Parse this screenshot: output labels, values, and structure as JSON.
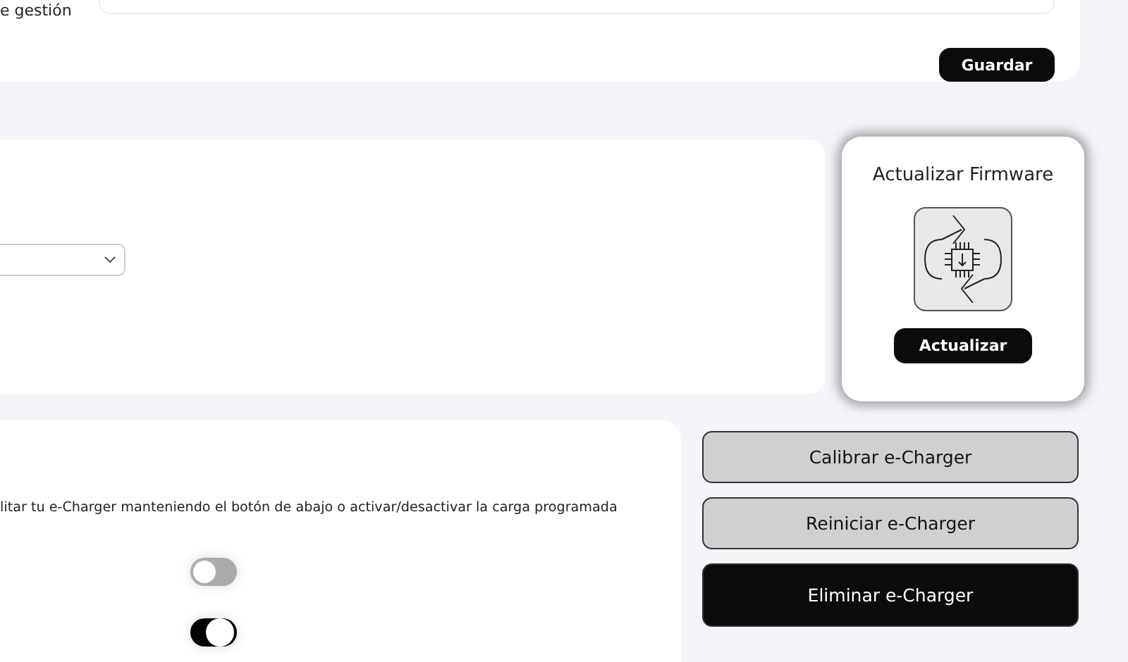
{
  "settings_form": {
    "label": "e gestión",
    "save_button": "Guardar"
  },
  "firmware": {
    "title": "Actualizar Firmware",
    "button": "Actualizar"
  },
  "controls": {
    "description": "litar tu e-Charger manteniendo el botón de abajo o activar/desactivar la carga programada",
    "toggles": [
      {
        "on": false
      },
      {
        "on": true
      }
    ]
  },
  "actions": [
    {
      "label": "Calibrar e-Charger",
      "kind": "secondary"
    },
    {
      "label": "Reiniciar e-Charger",
      "kind": "secondary"
    },
    {
      "label": "Eliminar e-Charger",
      "kind": "danger"
    }
  ]
}
